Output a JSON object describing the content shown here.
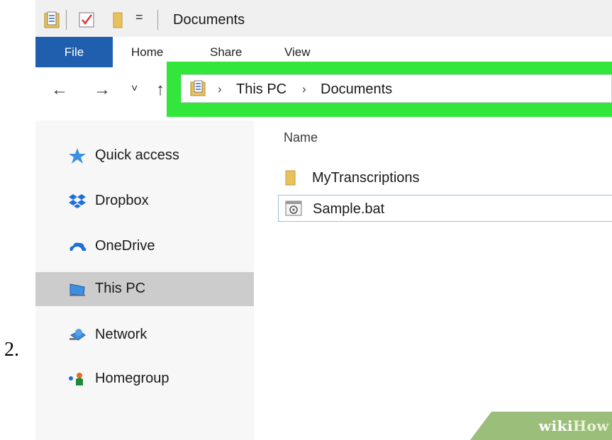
{
  "step_number": "2.",
  "window": {
    "title": "Documents",
    "quick_access_toolbar": {
      "properties_icon": "properties-icon",
      "checkmark_icon": "checkmark-icon",
      "folder_icon": "new-folder-icon",
      "dropdown_glyph": "="
    }
  },
  "ribbon": {
    "tabs": [
      {
        "label": "File",
        "active": true
      },
      {
        "label": "Home"
      },
      {
        "label": "Share"
      },
      {
        "label": "View"
      }
    ],
    "accent_color": "#1f5fae"
  },
  "navigation": {
    "back_glyph": "←",
    "forward_glyph": "→",
    "recent_glyph": "˅",
    "up_glyph": "↑"
  },
  "address_bar": {
    "highlight_color": "#32e63c",
    "crumbs": [
      "This PC",
      "Documents"
    ],
    "separator": "›"
  },
  "sidebar": {
    "items": [
      {
        "label": "Quick access",
        "icon": "star-icon"
      },
      {
        "label": "Dropbox",
        "icon": "dropbox-icon"
      },
      {
        "label": "OneDrive",
        "icon": "onedrive-cloud-icon"
      },
      {
        "label": "This PC",
        "icon": "computer-icon",
        "selected": true
      },
      {
        "label": "Network",
        "icon": "network-icon"
      },
      {
        "label": "Homegroup",
        "icon": "homegroup-icon"
      }
    ]
  },
  "content": {
    "column_header": "Name",
    "files": [
      {
        "name": "MyTranscriptions",
        "icon": "folder-icon"
      },
      {
        "name": "Sample.bat",
        "icon": "batch-file-icon",
        "selected": true
      }
    ]
  },
  "watermark": {
    "part1": "wiki",
    "part2": "How"
  }
}
